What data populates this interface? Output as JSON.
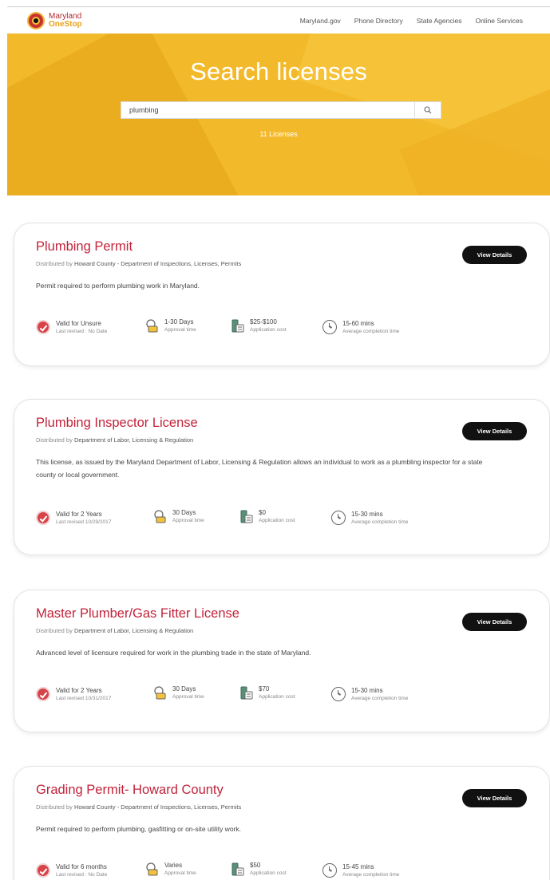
{
  "header": {
    "logo_line1": "Maryland",
    "logo_line2": "OneStop",
    "nav": [
      "Maryland.gov",
      "Phone Directory",
      "State Agencies",
      "Online Services"
    ]
  },
  "hero": {
    "title": "Search licenses",
    "search_value": "plumbing",
    "count": "11 Licenses"
  },
  "colors": {
    "brand_red": "#c2233a",
    "hero_yellow": "#f2b92a",
    "button_black": "#111111"
  },
  "cards": [
    {
      "title": "Plumbing Permit",
      "distributed_prefix": "Distributed by",
      "distributor": "Howard County - Department of Inspections, Licenses, Permits",
      "description": "Permit required to perform plumbing work in Maryland.",
      "button": "View Details",
      "validity": "Valid for Unsure",
      "revised": "Last revised : No Date",
      "approval": "1-30 Days",
      "approval_label": "Approval time",
      "cost": "$25-$100",
      "cost_label": "Application cost",
      "completion": "15-60 mins",
      "completion_label": "Average completion time"
    },
    {
      "title": "Plumbing Inspector License",
      "distributed_prefix": "Distributed by",
      "distributor": "Department of Labor, Licensing & Regulation",
      "description": "This license, as issued by the Maryland Department of Labor, Licensing & Regulation allows an individual to work as a plumbling inspector for a state county or local government.",
      "button": "View Details",
      "validity": "Valid for 2 Years",
      "revised": "Last revised 10/29/2017",
      "approval": "30 Days",
      "approval_label": "Approval time",
      "cost": "$0",
      "cost_label": "Application cost",
      "completion": "15-30 mins",
      "completion_label": "Average completion time"
    },
    {
      "title": "Master Plumber/Gas Fitter License",
      "distributed_prefix": "Distributed by",
      "distributor": "Department of Labor, Licensing & Regulation",
      "description": "Advanced level of licensure required for work in the plumbing trade in the state of Maryland.",
      "button": "View Details",
      "validity": "Valid for 2 Years",
      "revised": "Last revised 10/31/2017",
      "approval": "30 Days",
      "approval_label": "Approval time",
      "cost": "$70",
      "cost_label": "Application cost",
      "completion": "15-30 mins",
      "completion_label": "Average completion time"
    },
    {
      "title": "Grading Permit- Howard County",
      "distributed_prefix": "Distributed by",
      "distributor": "Howard County - Department of Inspections, Licenses, Permits",
      "description": "Permit required to perform plumbing, gasfitting or on-site utility work.",
      "button": "View Details",
      "validity": "Valid for 6 months",
      "revised": "Last revised : No Date",
      "approval": "Varies",
      "approval_label": "Approval time",
      "cost": "$50",
      "cost_label": "Application cost",
      "completion": "15-45 mins",
      "completion_label": "Average completion time"
    }
  ]
}
